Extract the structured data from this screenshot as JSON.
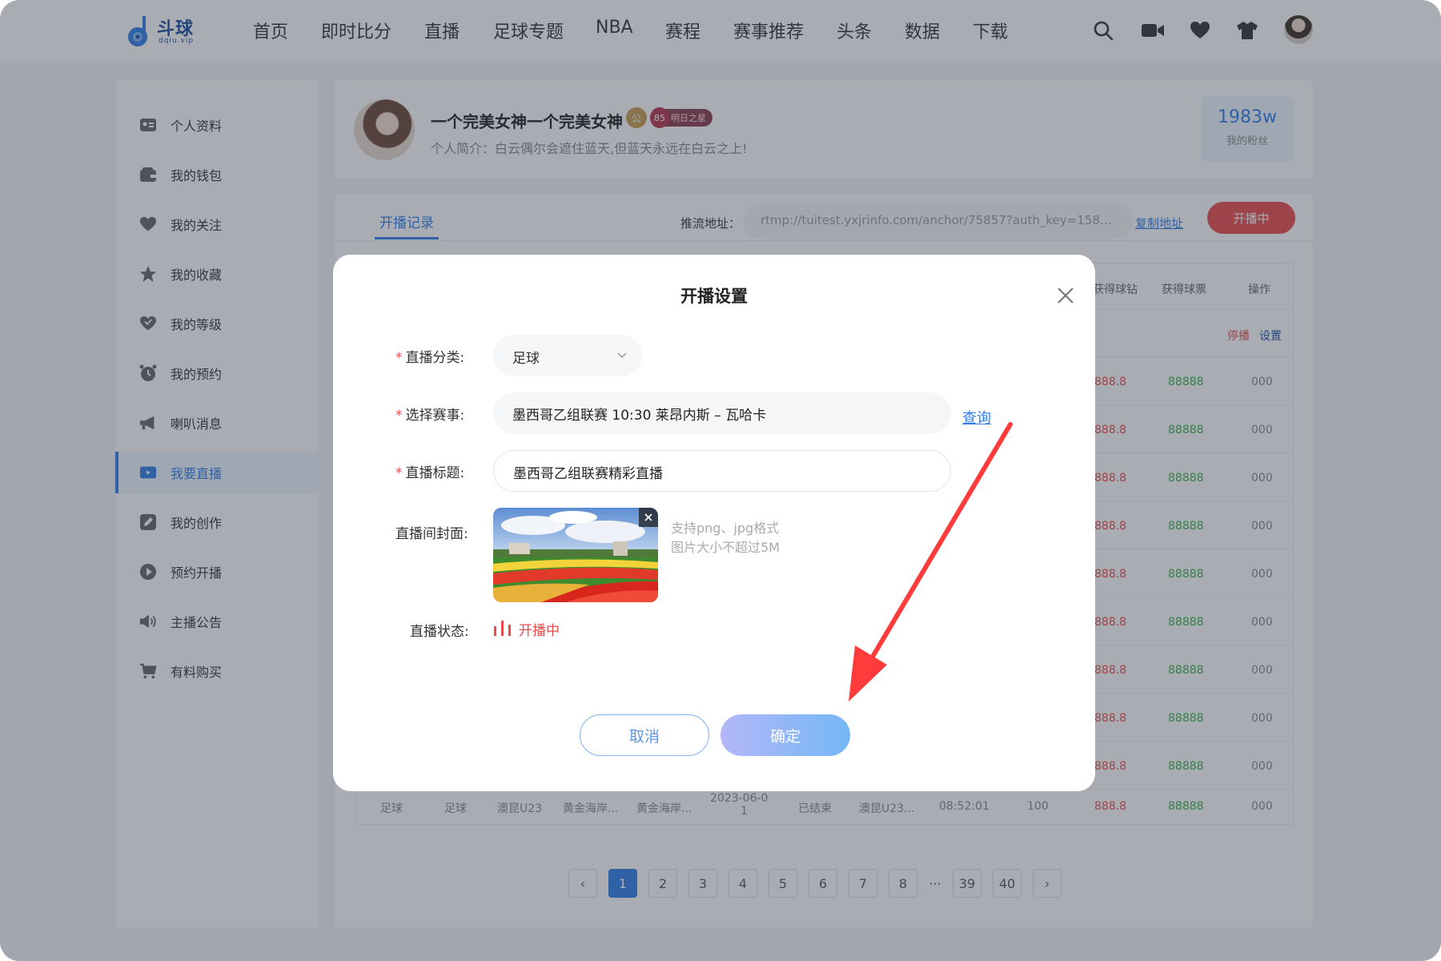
{
  "brand": {
    "name": "斗球",
    "domain": "dqiu.vip"
  },
  "nav": {
    "items": [
      "首页",
      "即时比分",
      "直播",
      "足球专题",
      "NBA",
      "赛程",
      "赛事推荐",
      "头条",
      "数据",
      "下载"
    ]
  },
  "sidebar": {
    "items": [
      {
        "label": "个人资料",
        "icon": "id-card-icon"
      },
      {
        "label": "我的钱包",
        "icon": "wallet-icon"
      },
      {
        "label": "我的关注",
        "icon": "heart-icon"
      },
      {
        "label": "我的收藏",
        "icon": "star-icon"
      },
      {
        "label": "我的等级",
        "icon": "level-heart-icon"
      },
      {
        "label": "我的预约",
        "icon": "alarm-clock-icon"
      },
      {
        "label": "喇叭消息",
        "icon": "megaphone-icon"
      },
      {
        "label": "我要直播",
        "icon": "tv-icon",
        "active": true
      },
      {
        "label": "我的创作",
        "icon": "pen-icon"
      },
      {
        "label": "预约开播",
        "icon": "play-circle-icon"
      },
      {
        "label": "主播公告",
        "icon": "speaker-icon"
      },
      {
        "label": "有料购买",
        "icon": "cart-icon"
      }
    ]
  },
  "profile": {
    "name": "一个完美女神一个完美女神",
    "badge_anchor": "公",
    "level": "85",
    "level_title": "明日之星",
    "bio": "个人简介：白云偶尔会遮住蓝天,但蓝天永远在白云之上!",
    "fans_count": "1983w",
    "fans_label": "我的粉丝"
  },
  "main": {
    "tab": "开播记录",
    "push_label": "推流地址：",
    "push_url": "rtmp://tuitest.yxjrinfo.com/anchor/75857?auth_key=15837...",
    "copy_label": "复制地址",
    "live_button": "开播中",
    "table": {
      "headers": [
        "获得球钻",
        "获得球票",
        "操作"
      ],
      "first_row_actions": {
        "stop": "停播",
        "settings": "设置"
      },
      "rows_values": [
        [
          "888.8",
          "88888",
          "000"
        ],
        [
          "888.8",
          "88888",
          "000"
        ],
        [
          "888.8",
          "88888",
          "000"
        ],
        [
          "888.8",
          "88888",
          "000"
        ],
        [
          "888.8",
          "88888",
          "000"
        ],
        [
          "888.8",
          "88888",
          "000"
        ],
        [
          "888.8",
          "88888",
          "000"
        ],
        [
          "888.8",
          "88888",
          "000"
        ],
        [
          "888.8",
          "88888",
          "000"
        ]
      ],
      "last_row": {
        "category": "足球",
        "sub": "足球",
        "home": "澳昆U23",
        "away1": "黄金海岸...",
        "away2": "黄金海岸...",
        "date_line1": "2023-06-0",
        "date_line2": "1",
        "status": "已结束",
        "title": "澳昆U23...",
        "duration": "08:52:01",
        "viewers": "100",
        "diamonds": "888.8",
        "tickets": "88888",
        "op": "000"
      }
    },
    "pagination": {
      "prev": "‹",
      "pages": [
        "1",
        "2",
        "3",
        "4",
        "5",
        "6",
        "7",
        "8"
      ],
      "ellipsis": "···",
      "tail": [
        "39",
        "40"
      ],
      "next": "›",
      "current": "1"
    }
  },
  "modal": {
    "title": "开播设置",
    "category_label": "直播分类:",
    "category_value": "足球",
    "match_label": "选择赛事:",
    "match_value": "墨西哥乙组联赛 10:30 莱昂内斯 – 瓦哈卡",
    "query_label": "查询",
    "title_label": "直播标题:",
    "title_value": "墨西哥乙组联赛精彩直播",
    "cover_label": "直播间封面:",
    "cover_hint1": "支持png、jpg格式",
    "cover_hint2": "图片大小不超过5M",
    "status_label": "直播状态:",
    "status_value": "开播中",
    "cancel": "取消",
    "confirm": "确定"
  },
  "colors": {
    "accent": "#2f7be8",
    "danger": "#e94a4a",
    "success": "#36b04a"
  }
}
